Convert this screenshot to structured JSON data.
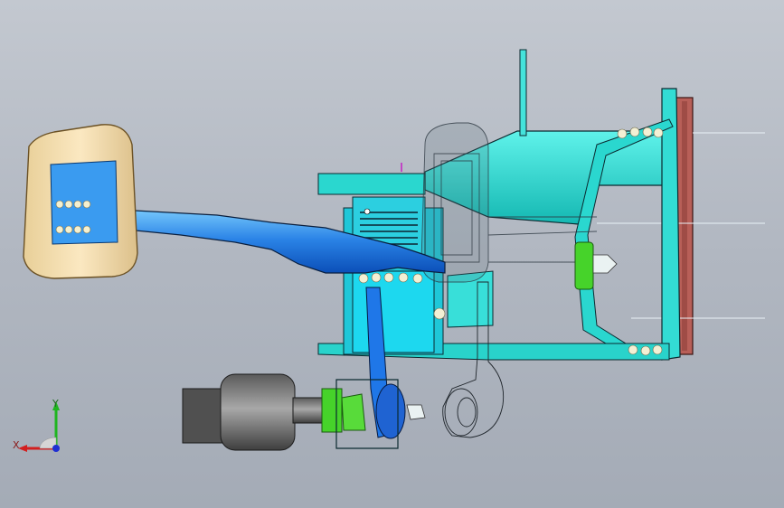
{
  "viewport": {
    "background_top": "#c3c8d0",
    "background_bottom": "#a4abb6"
  },
  "model": {
    "colors": {
      "pedal_pad": "#f1dcae",
      "pedal_pad_face": "#3a9bf0",
      "pedal_arm": "#2e86e6",
      "bracket": "#2ad7cf",
      "bracket_edge": "#0b2a30",
      "mount_plate": "#b05a55",
      "clip_green": "#46d32a",
      "sensor_gray": "#6e6e6e",
      "switch_blue": "#1f77e8"
    }
  },
  "triad": {
    "x_label": "X",
    "y_label": "Y",
    "x_color": "#d21f1f",
    "y_color": "#1fb51f",
    "z_color": "#1f2fd2"
  }
}
